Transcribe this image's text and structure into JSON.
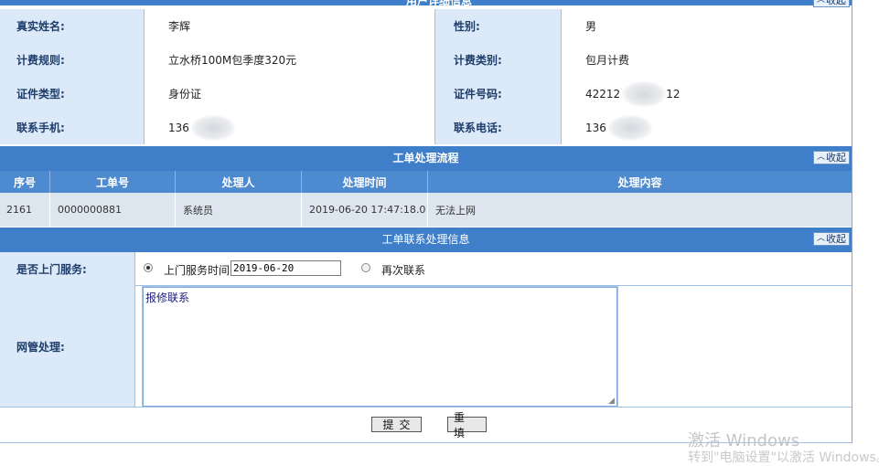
{
  "user_info": {
    "title": "用户详细信息",
    "collapse_label": "收起",
    "rows": [
      {
        "label1": "真实姓名:",
        "value1": "李辉",
        "label2": "性别:",
        "value2": "男"
      },
      {
        "label1": "计费规则:",
        "value1": "立水桥100M包季度320元",
        "label2": "计费类别:",
        "value2": "包月计费"
      },
      {
        "label1": "证件类型:",
        "value1": "身份证",
        "label2": "证件号码:",
        "value2": "42212",
        "value2_suffix": "12"
      },
      {
        "label1": "联系手机:",
        "value1": "136",
        "label2": "联系电话:",
        "value2": "136"
      }
    ]
  },
  "workflow": {
    "title": "工单处理流程",
    "collapse_label": "收起",
    "columns": [
      "序号",
      "工单号",
      "处理人",
      "处理时间",
      "处理内容"
    ],
    "rows": [
      {
        "seq": "2161",
        "order_no": "0000000881",
        "handler": "系统员",
        "time": "2019-06-20 17:47:18.0",
        "content": "无法上网"
      }
    ]
  },
  "contact": {
    "title": "工单联系处理信息",
    "collapse_label": "收起",
    "onsite_label": "是否上门服务:",
    "option_onsite": "上门服务时间",
    "onsite_date": "2019-06-20",
    "option_recontact": "再次联系",
    "admin_label": "网管处理:",
    "admin_text": "报修联系",
    "submit_label": "提交",
    "reset_label": "重填"
  },
  "watermark": {
    "line1": "激活 Windows",
    "line2": "转到\"电脑设置\"以激活 Windows。"
  }
}
